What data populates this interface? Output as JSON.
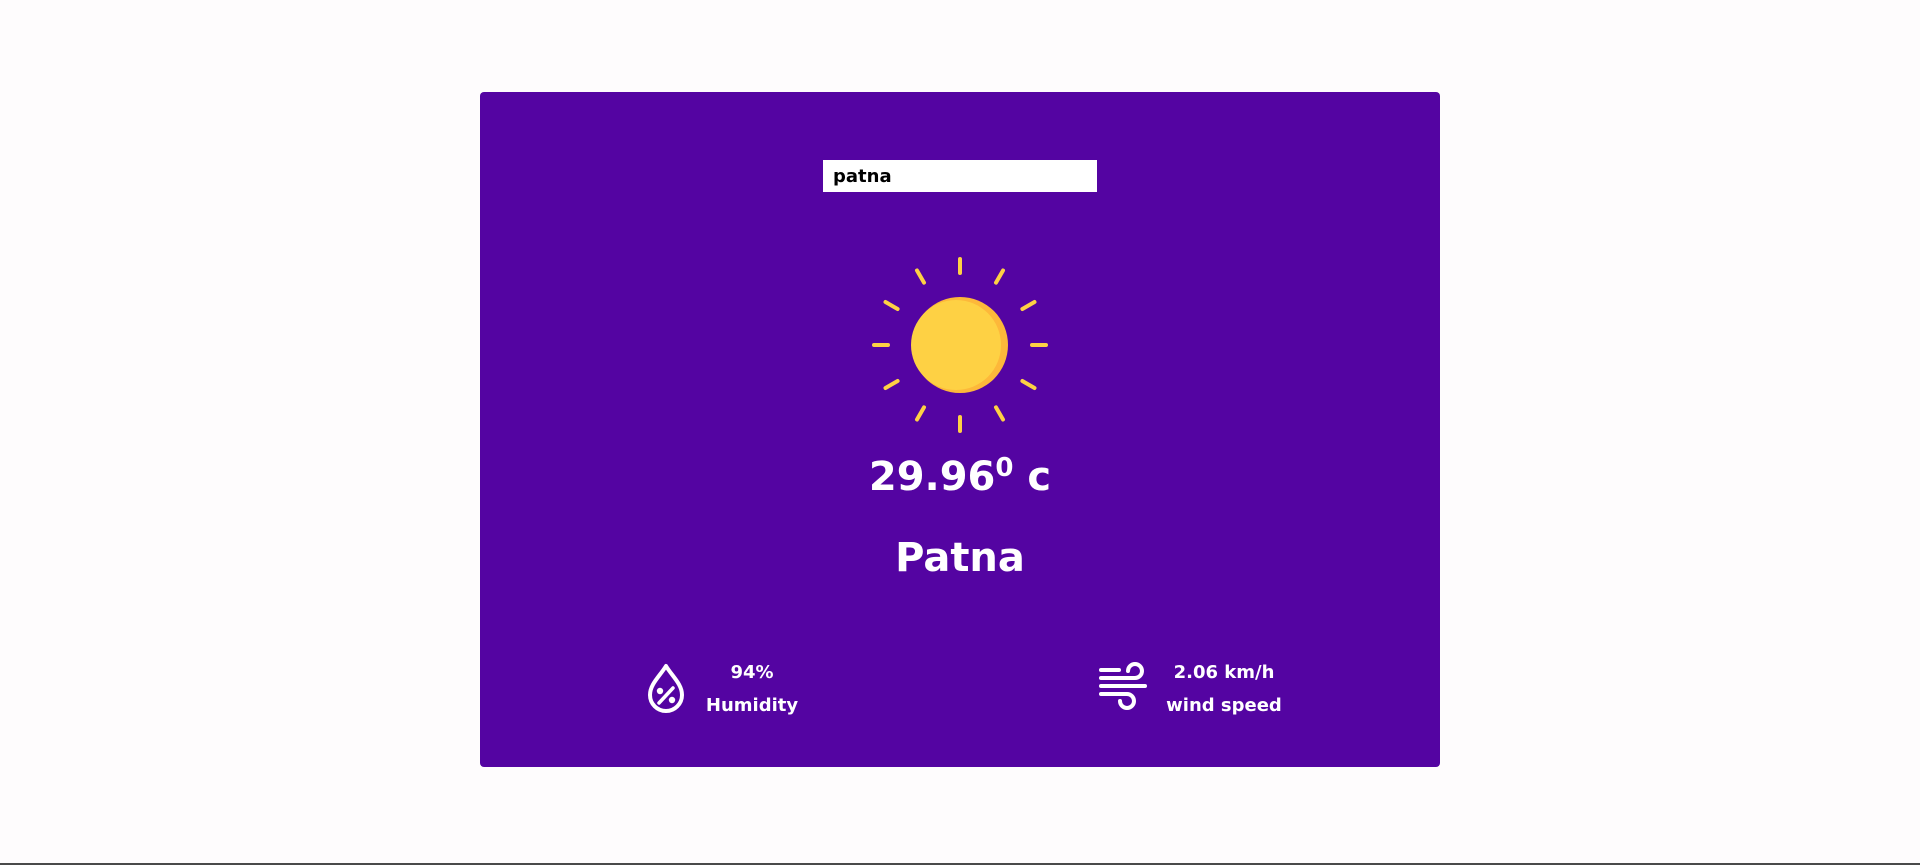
{
  "search": {
    "value": "patna"
  },
  "weather": {
    "icon": "sun-icon",
    "temperature": "29.96",
    "degree_symbol": "0",
    "unit": "c",
    "city": "Patna"
  },
  "details": {
    "humidity": {
      "icon": "humidity-drop-icon",
      "value": "94%",
      "label": "Humidity"
    },
    "wind": {
      "icon": "wind-icon",
      "value": "2.06 km/h",
      "label": "wind speed"
    }
  },
  "colors": {
    "card_background": "#5404a2",
    "sun": "#fed144",
    "page_background": "#fefcfd"
  }
}
